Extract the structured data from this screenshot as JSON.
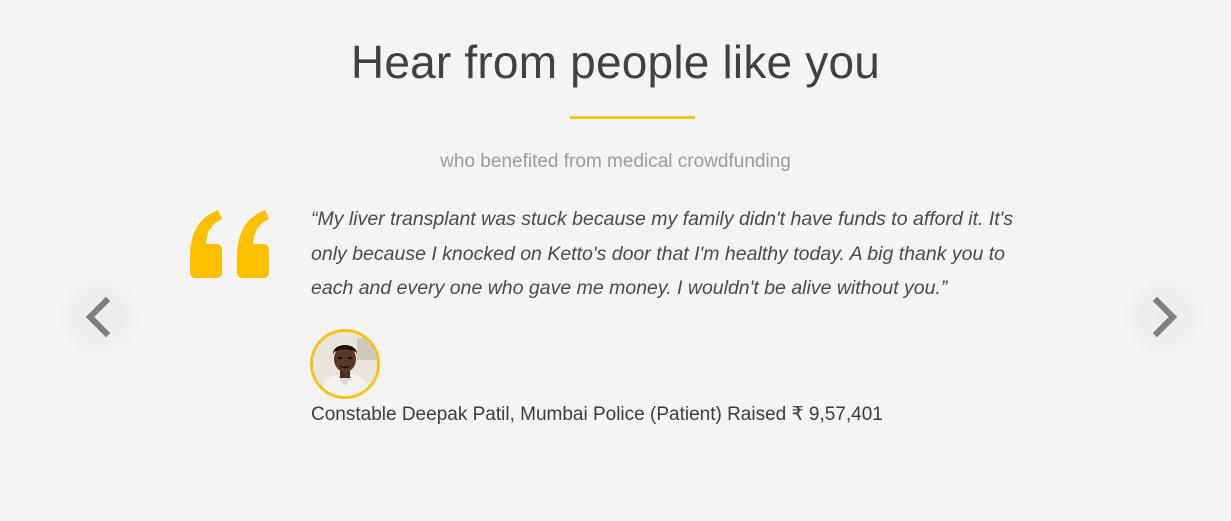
{
  "section": {
    "title": "Hear from people like you",
    "subtitle": "who benefited from medical crowdfunding"
  },
  "testimonial": {
    "quote": "“My liver transplant was stuck because my family didn't have funds to afford it. It's only because I knocked on Ketto's door that I'm healthy today. A big thank you to each and every one who gave me money. I wouldn't be alive without you.”",
    "author": "Constable Deepak Patil, Mumbai Police (Patient) Raised ₹ 9,57,401",
    "avatar_icon": "person-photo",
    "quote_icon": "quote-mark-icon"
  },
  "navigation": {
    "prev_icon": "chevron-left-icon",
    "next_icon": "chevron-right-icon"
  },
  "colors": {
    "accent": "#f6c318",
    "quote_mark": "#fdbf00",
    "title": "#414141",
    "subtitle": "#9a9a9a",
    "background": "#f4f4f4",
    "chevron": "#7f7f7f"
  }
}
